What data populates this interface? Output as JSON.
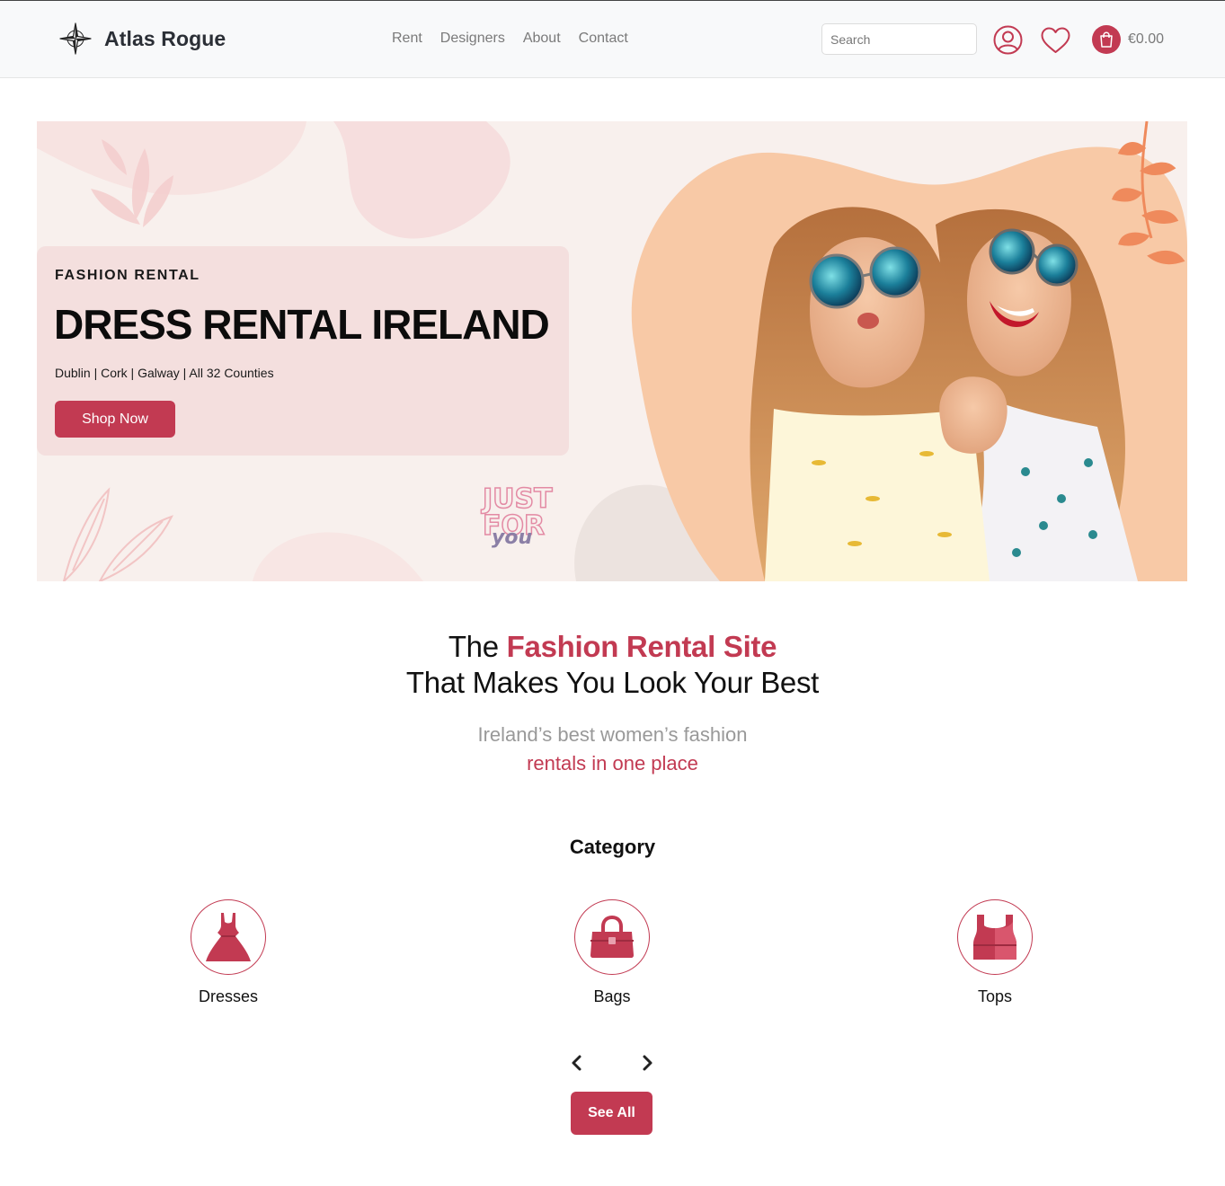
{
  "colors": {
    "accent": "#c23a52",
    "nav_bg": "#f8f9fa",
    "hero_card_bg": "#f2dcdc",
    "muted_text": "#7a7a7a"
  },
  "header": {
    "brand_name": "Atlas Rogue",
    "brand_icon": "compass-star-icon",
    "nav": [
      "Rent",
      "Designers",
      "About",
      "Contact"
    ],
    "search_placeholder": "Search",
    "account_icon": "user-icon",
    "wishlist_icon": "heart-icon",
    "cart_icon": "shopping-bag-icon",
    "cart_total": "€0.00"
  },
  "hero": {
    "eyebrow": "FASHION RENTAL",
    "title": "DRESS RENTAL IRELAND",
    "subtitle": "Dublin | Cork | Galway | All 32 Counties",
    "cta": "Shop Now",
    "badge_lines": [
      "JUST",
      "FOR",
      "you"
    ]
  },
  "tagline": {
    "line1_prefix": "The ",
    "line1_accent": "Fashion Rental Site",
    "line2": "That Makes You Look Your Best",
    "sub_gray": "Ireland’s best women’s fashion",
    "sub_accent": "rentals in one place"
  },
  "categories": {
    "heading": "Category",
    "items": [
      {
        "label": "Dresses",
        "icon": "dress-icon"
      },
      {
        "label": "Bags",
        "icon": "handbag-icon"
      },
      {
        "label": "Tops",
        "icon": "top-icon"
      }
    ],
    "prev_icon": "chevron-left-icon",
    "next_icon": "chevron-right-icon",
    "see_all": "See All"
  }
}
